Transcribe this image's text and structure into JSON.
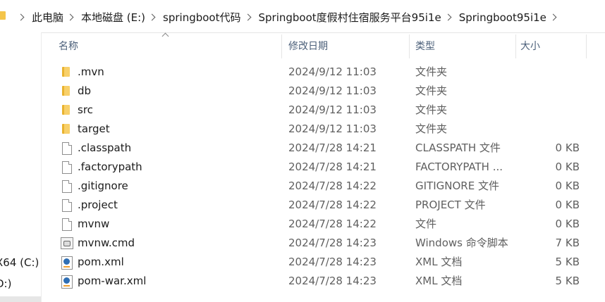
{
  "breadcrumbs": [
    "此电脑",
    "本地磁盘 (E:)",
    "springboot代码",
    "Springboot度假村住宿服务平台95i1e",
    "Springboot95i1e"
  ],
  "nav": {
    "items": [
      "X64 (C:)",
      "D:)"
    ]
  },
  "columns": {
    "name": "名称",
    "date": "修改日期",
    "type": "类型",
    "size": "大小"
  },
  "files": [
    {
      "name": ".mvn",
      "date": "2024/9/12 11:03",
      "type": "文件夹",
      "size": "",
      "icon": "folder-icon"
    },
    {
      "name": "db",
      "date": "2024/9/12 11:03",
      "type": "文件夹",
      "size": "",
      "icon": "folder-icon"
    },
    {
      "name": "src",
      "date": "2024/9/12 11:03",
      "type": "文件夹",
      "size": "",
      "icon": "folder-icon"
    },
    {
      "name": "target",
      "date": "2024/9/12 11:03",
      "type": "文件夹",
      "size": "",
      "icon": "folder-icon"
    },
    {
      "name": ".classpath",
      "date": "2024/7/28 14:21",
      "type": "CLASSPATH 文件",
      "size": "0 KB",
      "icon": "file-icon"
    },
    {
      "name": ".factorypath",
      "date": "2024/7/28 14:21",
      "type": "FACTORYPATH ...",
      "size": "0 KB",
      "icon": "file-icon"
    },
    {
      "name": ".gitignore",
      "date": "2024/7/28 14:22",
      "type": "GITIGNORE 文件",
      "size": "0 KB",
      "icon": "file-icon"
    },
    {
      "name": ".project",
      "date": "2024/7/28 14:22",
      "type": "PROJECT 文件",
      "size": "0 KB",
      "icon": "file-icon"
    },
    {
      "name": "mvnw",
      "date": "2024/7/28 14:22",
      "type": "文件",
      "size": "0 KB",
      "icon": "file-icon"
    },
    {
      "name": "mvnw.cmd",
      "date": "2024/7/28 14:23",
      "type": "Windows 命令脚本",
      "size": "7 KB",
      "icon": "cmd-script-icon"
    },
    {
      "name": "pom.xml",
      "date": "2024/7/28 14:23",
      "type": "XML 文档",
      "size": "5 KB",
      "icon": "xml-document-icon"
    },
    {
      "name": "pom-war.xml",
      "date": "2024/7/28 14:23",
      "type": "XML 文档",
      "size": "5 KB",
      "icon": "xml-document-icon"
    }
  ]
}
